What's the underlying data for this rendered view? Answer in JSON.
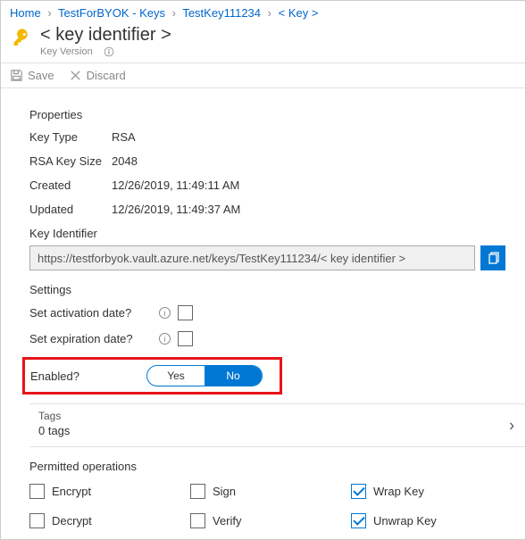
{
  "breadcrumb": {
    "items": [
      {
        "label": "Home"
      },
      {
        "label": "TestForBYOK - Keys"
      },
      {
        "label": "TestKey111234"
      },
      {
        "label": "< Key >"
      }
    ]
  },
  "header": {
    "title": "< key identifier >",
    "subtitle": "Key Version"
  },
  "toolbar": {
    "save_label": "Save",
    "discard_label": "Discard"
  },
  "properties": {
    "heading": "Properties",
    "rows": [
      {
        "label": "Key Type",
        "value": "RSA"
      },
      {
        "label": "RSA Key Size",
        "value": "2048"
      },
      {
        "label": "Created",
        "value": "12/26/2019, 11:49:11 AM"
      },
      {
        "label": "Updated",
        "value": "12/26/2019, 11:49:37 AM"
      }
    ],
    "key_identifier_label": "Key Identifier",
    "key_identifier_value": "https://testforbyok.vault.azure.net/keys/TestKey111234/< key identifier >"
  },
  "settings": {
    "heading": "Settings",
    "activation_label": "Set activation date?",
    "expiration_label": "Set expiration date?",
    "enabled_label": "Enabled?",
    "yes_label": "Yes",
    "no_label": "No"
  },
  "tags": {
    "title": "Tags",
    "count": "0 tags"
  },
  "permitted": {
    "heading": "Permitted operations",
    "ops": [
      {
        "label": "Encrypt",
        "checked": false
      },
      {
        "label": "Sign",
        "checked": false
      },
      {
        "label": "Wrap Key",
        "checked": true
      },
      {
        "label": "Decrypt",
        "checked": false
      },
      {
        "label": "Verify",
        "checked": false
      },
      {
        "label": "Unwrap Key",
        "checked": true
      }
    ]
  }
}
